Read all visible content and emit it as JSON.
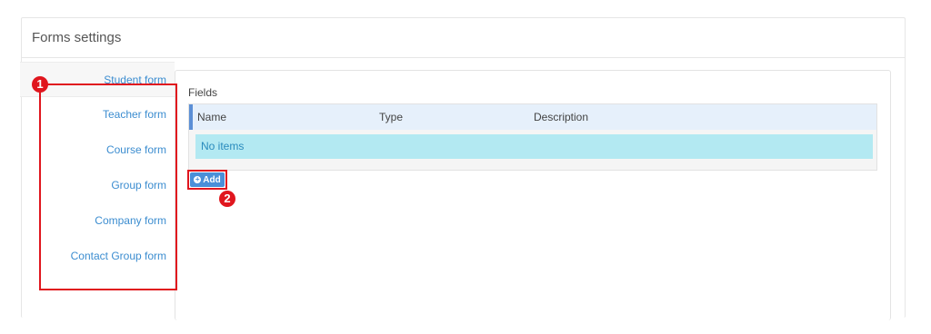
{
  "panel": {
    "title": "Forms settings"
  },
  "sidebar": {
    "tabs": [
      {
        "label": "Student form",
        "active": true
      },
      {
        "label": "Teacher form",
        "active": false
      },
      {
        "label": "Course form",
        "active": false
      },
      {
        "label": "Group form",
        "active": false
      },
      {
        "label": "Company form",
        "active": false
      },
      {
        "label": "Contact Group form",
        "active": false
      }
    ]
  },
  "fields": {
    "title": "Fields",
    "columns": [
      "Name",
      "Type",
      "Description"
    ],
    "empty_text": "No items",
    "add_label": "Add"
  },
  "annotations": [
    "1",
    "2"
  ],
  "colors": {
    "accent": "#3c8dd0",
    "annotation": "#e0161e",
    "empty_row": "#b3e9f2",
    "button": "#4a8fd8"
  }
}
